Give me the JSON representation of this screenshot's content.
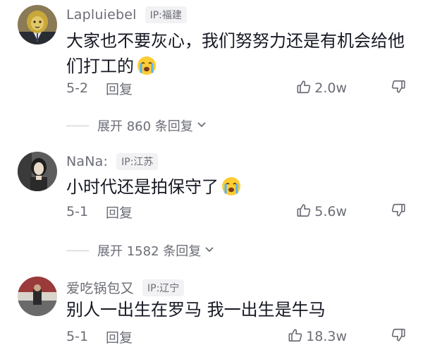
{
  "comments": [
    {
      "username": "Lapluiebel",
      "ip": "IP:福建",
      "text_line1": "大家也不要灰心，我们努努力还是有机会给他",
      "text_line2": "们打工的",
      "date": "5-2",
      "reply_label": "回复",
      "likes": "2.0w"
    },
    {
      "username": "NaNa:",
      "ip": "IP:江苏",
      "text_line1": "小时代还是拍保守了",
      "date": "5-1",
      "reply_label": "回复",
      "likes": "5.6w"
    },
    {
      "username": "爱吃锅包又",
      "ip": "IP:辽宁",
      "text_line1": "别人一出生在罗马 我一出生是牛马",
      "date": "5-1",
      "reply_label": "回复",
      "likes": "18.3w"
    }
  ],
  "expand": [
    {
      "label": "展开 860 条回复"
    },
    {
      "label": "展开 1582 条回复"
    }
  ],
  "icons": {
    "like": "thumbs-up-icon",
    "dislike": "thumbs-down-icon",
    "emoji": "crying-face-icon",
    "chevron": "chevron-down-icon"
  },
  "colors": {
    "text": "#161823",
    "secondary": "#6b6d76",
    "badge_bg": "#f2f2f4"
  }
}
